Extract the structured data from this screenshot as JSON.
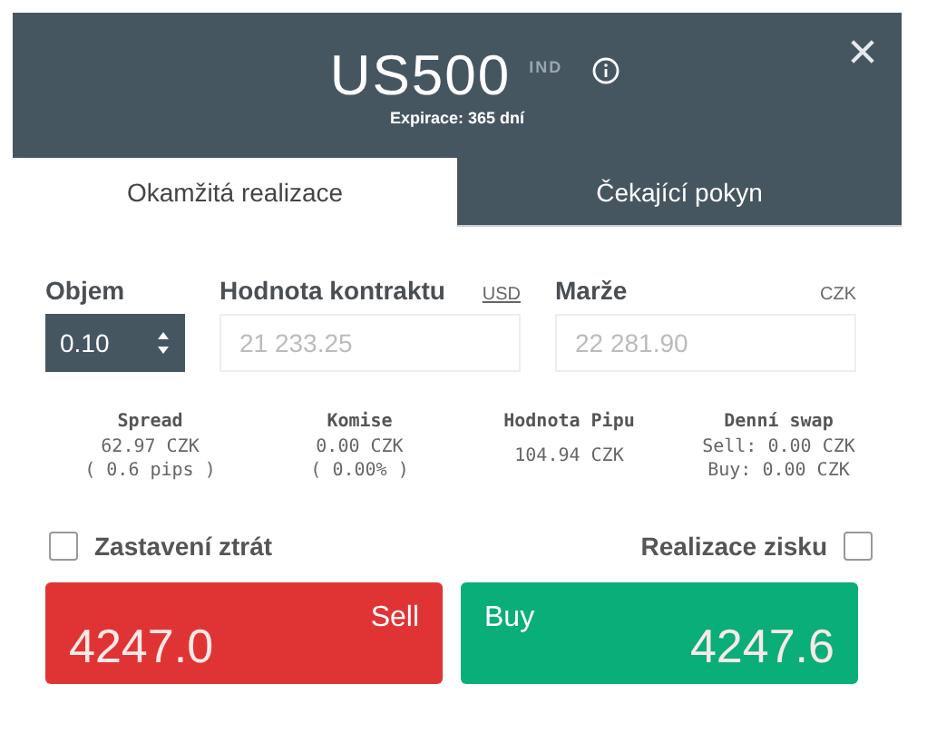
{
  "header": {
    "symbol": "US500",
    "type_tag": "IND",
    "expiry": "Expirace: 365 dní"
  },
  "tabs": [
    {
      "label": "Okamžitá realizace",
      "selected": true
    },
    {
      "label": "Čekající pokyn",
      "selected": false
    }
  ],
  "volume": {
    "label": "Objem",
    "value": "0.10"
  },
  "contract_value": {
    "label": "Hodnota kontraktu",
    "currency": "USD",
    "value": "21 233.25"
  },
  "margin": {
    "label": "Marže",
    "currency": "CZK",
    "value": "22 281.90"
  },
  "stats": [
    {
      "label": "Spread",
      "lines": [
        "62.97 CZK",
        "( 0.6 pips )"
      ]
    },
    {
      "label": "Komise",
      "lines": [
        "0.00 CZK",
        "( 0.00% )"
      ]
    },
    {
      "label": "Hodnota Pipu",
      "lines": [
        "104.94 CZK"
      ]
    },
    {
      "label": "Denní swap",
      "lines": [
        "Sell: 0.00 CZK",
        "Buy: 0.00 CZK"
      ]
    }
  ],
  "stop_loss": {
    "label": "Zastavení ztrát",
    "checked": false
  },
  "take_profit": {
    "label": "Realizace zisku",
    "checked": false
  },
  "orders": [
    {
      "kind": "sell",
      "label": "Sell",
      "price": "4247.**0**"
    },
    {
      "kind": "buy",
      "label": "Buy",
      "price": "4247.**6**"
    }
  ]
}
